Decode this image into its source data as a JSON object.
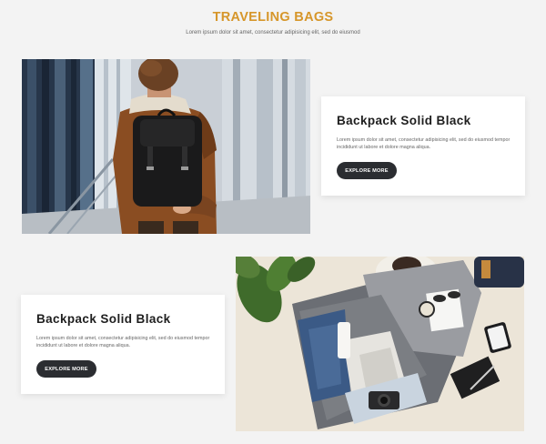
{
  "header": {
    "title": "TRAVELING BAGS",
    "subtitle": "Lorem ipsum dolor sit amet, consectetur adipisicing elit, sed do eiusmod"
  },
  "products": [
    {
      "title": "Backpack Solid Black",
      "description": "Lorem ipsum dolor sit amet, consectetur adipisicing elit, sed do eiusmod tempor incididunt ut labore et dolore magna aliqua.",
      "button_label": "EXPLORE MORE"
    },
    {
      "title": "Backpack Solid Black",
      "description": "Lorem ipsum dolor sit amet, consectetur adipisicing elit, sed do eiusmod tempor incididunt ut labore et dolore magna aliqua.",
      "button_label": "EXPLORE MORE"
    }
  ],
  "colors": {
    "accent": "#d6962a",
    "button_bg": "#2b2d31",
    "page_bg": "#f3f3f3"
  }
}
